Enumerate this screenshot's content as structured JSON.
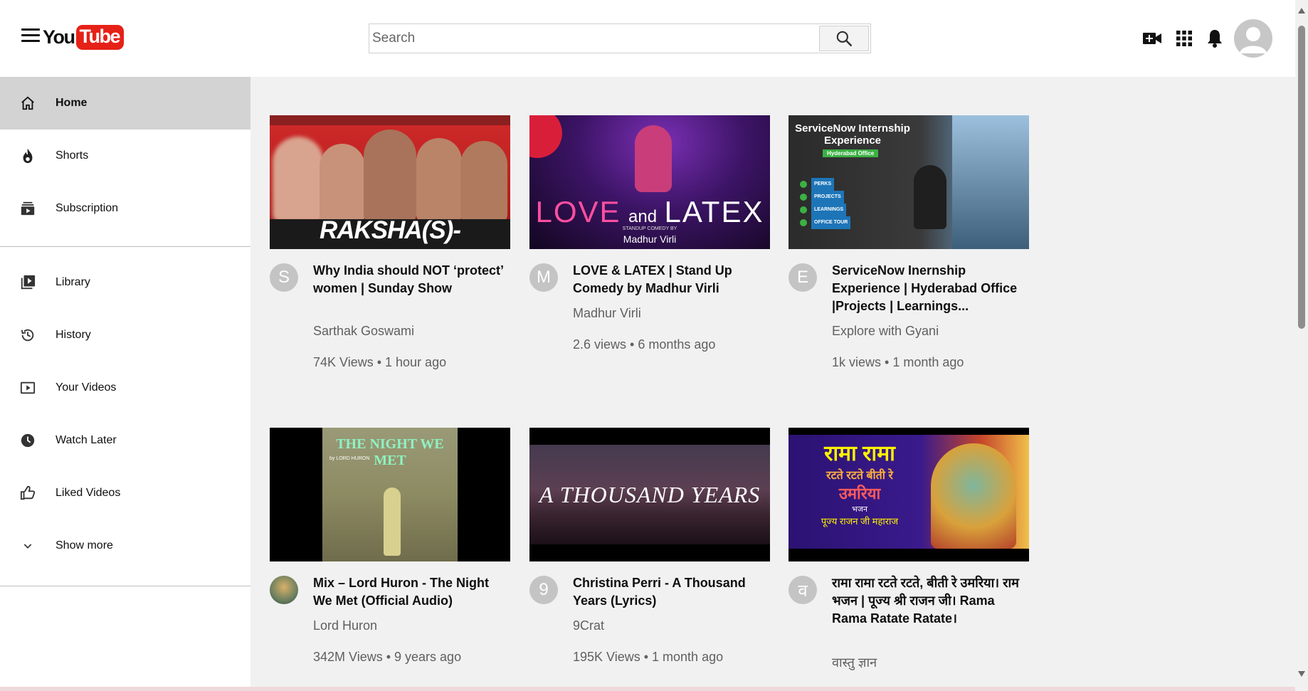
{
  "header": {
    "logo_you": "You",
    "logo_tube": "Tube",
    "search_placeholder": "Search",
    "icons": [
      "menu-icon",
      "search-icon",
      "video-camera-icon",
      "apps-grid-icon",
      "bell-icon",
      "user-avatar-icon"
    ]
  },
  "sidebar": {
    "items": [
      {
        "label": "Home",
        "icon": "home-icon",
        "active": true
      },
      {
        "label": "Shorts",
        "icon": "flame-icon"
      },
      {
        "label": "Subscription",
        "icon": "subscriptions-icon"
      },
      {
        "label": "Library",
        "icon": "library-icon"
      },
      {
        "label": "History",
        "icon": "history-icon"
      },
      {
        "label": "Your Videos",
        "icon": "your-videos-icon"
      },
      {
        "label": "Watch Later",
        "icon": "clock-icon"
      },
      {
        "label": "Liked Videos",
        "icon": "thumbs-up-icon"
      },
      {
        "label": "Show more",
        "icon": "chevron-down-icon"
      }
    ]
  },
  "videos": [
    {
      "title": "Why India should NOT ‘protect’ women | Sunday Show",
      "channel": "Sarthak Goswami",
      "stats": "74K Views • 1 hour ago",
      "avatar_letter": "S",
      "thumb_text": "RAKSHA(S)-BANDHAN"
    },
    {
      "title": "LOVE & LATEX | Stand Up Comedy by Madhur Virli",
      "channel": "Madhur Virli",
      "stats": "2.6 views • 6 months ago",
      "avatar_letter": "M",
      "thumb_text": "LOVE",
      "thumb_text2": "and",
      "thumb_text3": "LATEX",
      "thumb_sub": "STANDUP COMEDY BY",
      "thumb_sub2": "Madhur Virli"
    },
    {
      "title": "ServiceNow Inernship Experience | Hyderabad Office |Projects | Learnings...",
      "channel": "Explore with Gyani",
      "stats": "1k views • 1 month ago",
      "avatar_letter": "E",
      "thumb_text": "ServiceNow Internship",
      "thumb_text2": "Experience",
      "thumb_sub": "Hyderabad Office",
      "thumb_list": [
        "PERKS",
        "PROJECTS",
        "LEARNINGS",
        "OFFICE TOUR"
      ]
    },
    {
      "title": "Mix – Lord Huron - The Night We Met (Official Audio)",
      "channel": "Lord Huron",
      "stats": "342M Views • 9 years ago",
      "avatar_letter": "",
      "thumb_text": "THE NIGHT WE MET",
      "thumb_sub": "by LORD HURON"
    },
    {
      "title": "Christina Perri - A Thousand Years (Lyrics)",
      "channel": "9Crat",
      "stats": "195K Views • 1 month ago",
      "avatar_letter": "9",
      "thumb_text": "A THOUSAND YEARS"
    },
    {
      "title": "रामा रामा रटते रटते, बीती रे उमरिया। राम भजन | पूज्य श्री राजन जी। Rama Rama Ratate Ratate।",
      "channel": "वास्तु ज्ञान",
      "stats": "",
      "avatar_letter": "व",
      "thumb_text": "रामा रामा",
      "thumb_text2": "रटते रटते बीती रे",
      "thumb_text3": "उमरिया",
      "thumb_sub": "भजन",
      "thumb_sub2": "पूज्य राजन जी महाराज"
    }
  ],
  "colors": {
    "logo_red": "#e62117",
    "sidebar_active": "#d3d3d3",
    "content_bg": "#f1f1f1",
    "secondary_text": "#606060"
  }
}
